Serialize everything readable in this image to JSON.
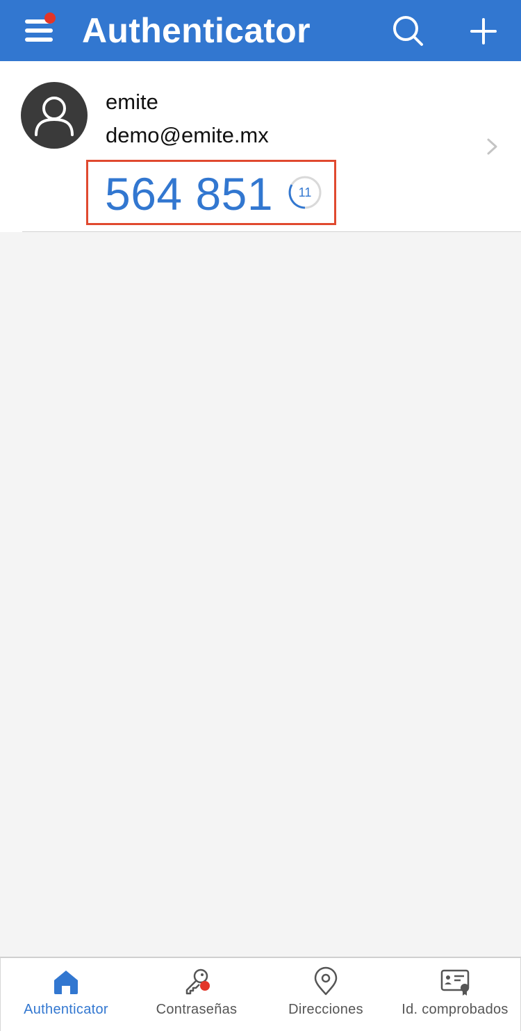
{
  "header": {
    "title": "Authenticator",
    "menu_icon": "hamburger-menu-icon",
    "search_icon": "search-icon",
    "add_icon": "plus-icon",
    "accent": "#3277d0",
    "notification_dot_color": "#e23528"
  },
  "account": {
    "name": "emite",
    "email": "demo@emite.mx",
    "code": "564 851",
    "timer_seconds": "11",
    "avatar_icon": "user-avatar-icon",
    "chevron_icon": "chevron-right-icon",
    "highlight_color": "#e0492f"
  },
  "bottom_nav": {
    "items": [
      {
        "label": "Authenticator",
        "icon": "home-icon",
        "active": true
      },
      {
        "label": "Contraseñas",
        "icon": "key-icon",
        "active": false
      },
      {
        "label": "Direcciones",
        "icon": "location-pin-icon",
        "active": false
      },
      {
        "label": "Id. comprobados",
        "icon": "id-card-icon",
        "active": false
      }
    ]
  }
}
